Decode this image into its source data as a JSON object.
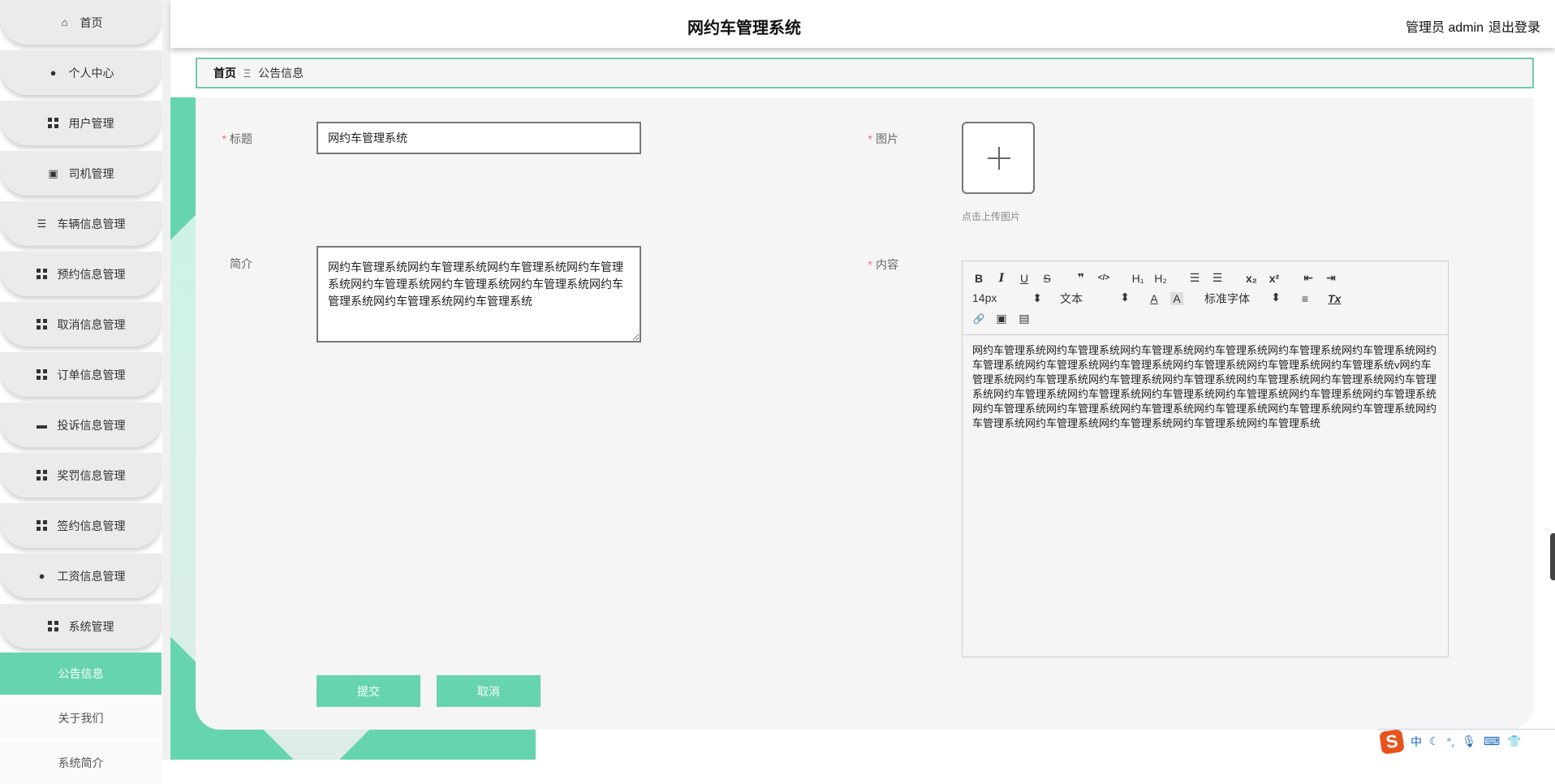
{
  "header": {
    "title": "网约车管理系统",
    "user": "管理员 admin",
    "logout": "退出登录"
  },
  "sidebar": {
    "items": [
      {
        "label": "首页",
        "icon": "home-icon"
      },
      {
        "label": "个人中心",
        "icon": "user-icon"
      },
      {
        "label": "用户管理",
        "icon": "grid-icon"
      },
      {
        "label": "司机管理",
        "icon": "clipboard-icon"
      },
      {
        "label": "车辆信息管理",
        "icon": "list-icon"
      },
      {
        "label": "预约信息管理",
        "icon": "grid-icon"
      },
      {
        "label": "取消信息管理",
        "icon": "grid-icon"
      },
      {
        "label": "订单信息管理",
        "icon": "grid-icon"
      },
      {
        "label": "投诉信息管理",
        "icon": "briefcase-icon"
      },
      {
        "label": "奖罚信息管理",
        "icon": "grid-icon"
      },
      {
        "label": "签约信息管理",
        "icon": "grid-icon"
      },
      {
        "label": "工资信息管理",
        "icon": "bulb-icon"
      },
      {
        "label": "系统管理",
        "icon": "grid-icon"
      }
    ],
    "sub_items": [
      {
        "label": "公告信息",
        "active": true
      },
      {
        "label": "关于我们",
        "active": false
      },
      {
        "label": "系统简介",
        "active": false
      }
    ]
  },
  "breadcrumb": {
    "home": "首页",
    "sep": "Ξ",
    "current": "公告信息"
  },
  "form": {
    "title_label": "标题",
    "title_value": "网约车管理系统",
    "intro_label": "简介",
    "intro_value": "网约车管理系统网约车管理系统网约车管理系统网约车管理系统网约车管理系统网约车管理系统网约车管理系统网约车管理系统网约车管理系统网约车管理系统",
    "image_label": "图片",
    "upload_hint": "点击上传图片",
    "content_label": "内容",
    "content_value": "网约车管理系统网约车管理系统网约车管理系统网约车管理系统网约车管理系统网约车管理系统网约车管理系统网约车管理系统网约车管理系统网约车管理系统网约车管理系统网约车管理系统v网约车管理系统网约车管理系统网约车管理系统网约车管理系统网约车管理系统网约车管理系统网约车管理系统网约车管理系统网约车管理系统网约车管理系统网约车管理系统网约车管理系统网约车管理系统网约车管理系统网约车管理系统网约车管理系统网约车管理系统网约车管理系统网约车管理系统网约车管理系统网约车管理系统网约车管理系统网约车管理系统网约车管理系统",
    "submit": "提交",
    "cancel": "取消"
  },
  "editor": {
    "font_size": "14px",
    "header_select": "文本",
    "font_family": "标准字体",
    "tools": {
      "bold": "B",
      "italic": "I",
      "underline": "U",
      "strike": "S",
      "quote": "❞",
      "code": "</>",
      "h1": "H₁",
      "h2": "H₂",
      "ol": "☰",
      "ul": "☰",
      "sub": "x₂",
      "sup": "x²",
      "outdent": "⇤",
      "indent": "⇥",
      "color": "A",
      "background": "A",
      "align": "≡",
      "clean": "Tx",
      "link": "🔗",
      "image": "▣",
      "video": "▤"
    }
  },
  "ime": {
    "lang": "中"
  },
  "colors": {
    "accent": "#67d4b0",
    "border": "#74c9ab"
  }
}
